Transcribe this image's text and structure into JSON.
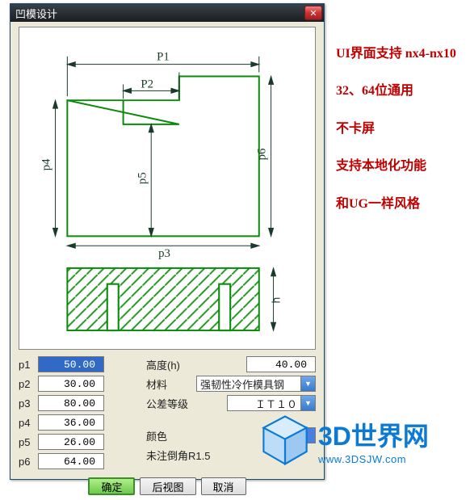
{
  "dialog": {
    "title": "凹模设计",
    "close_glyph": "✕"
  },
  "params": {
    "p1": {
      "label": "p1",
      "value": "50.00"
    },
    "p2": {
      "label": "p2",
      "value": "30.00"
    },
    "p3": {
      "label": "p3",
      "value": "80.00"
    },
    "p4": {
      "label": "p4",
      "value": "36.00"
    },
    "p5": {
      "label": "p5",
      "value": "26.00"
    },
    "p6": {
      "label": "p6",
      "value": "64.00"
    }
  },
  "right": {
    "height_label": "高度(h)",
    "height_value": "40.00",
    "material_label": "材料",
    "material_value": "强韧性冷作模具钢",
    "tolerance_label": "公差等级",
    "tolerance_value": "ＩＴ１０",
    "color_label": "颜色",
    "color_value": "#4a7fe0",
    "chamfer_label": "未注倒角R1.5"
  },
  "buttons": {
    "ok": "确定",
    "back_view": "后视图",
    "cancel": "取消"
  },
  "diagram_labels": {
    "P1": "P1",
    "P2": "P2",
    "p3": "p3",
    "p4": "p4",
    "p5": "p5",
    "p6": "p6",
    "h": "h"
  },
  "side_notes": [
    "UI界面支持 nx4-nx10",
    "32、64位通用",
    "不卡屏",
    "支持本地化功能",
    "和UG一样风格"
  ],
  "watermark": {
    "main": "3D世界网",
    "sub": "www.3DSJW.com"
  }
}
